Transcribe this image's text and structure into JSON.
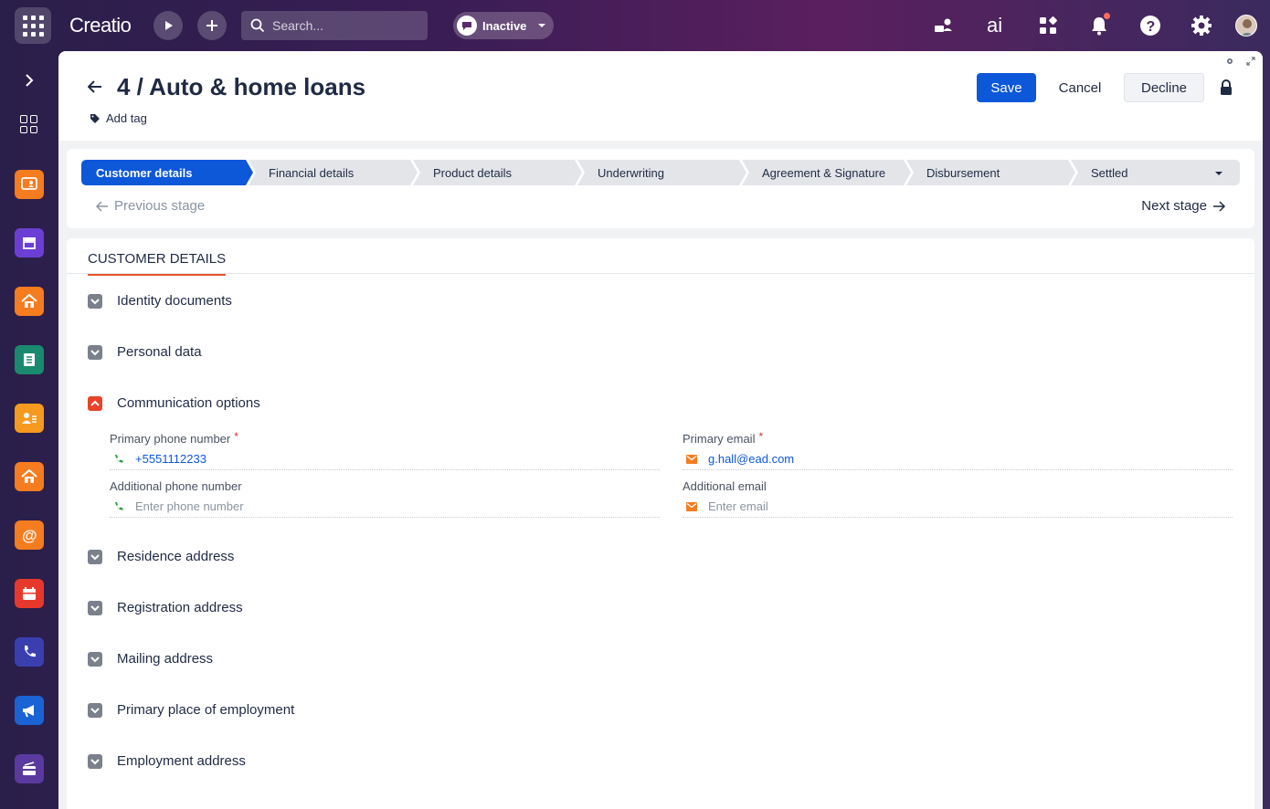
{
  "app": {
    "logo": "Creatio"
  },
  "search": {
    "placeholder": "Search..."
  },
  "status": {
    "label": "Inactive"
  },
  "record": {
    "title": "4 / Auto & home loans",
    "add_tag": "Add tag"
  },
  "actions": {
    "save": "Save",
    "cancel": "Cancel",
    "decline": "Decline"
  },
  "stages": [
    {
      "label": "Customer details",
      "active": true
    },
    {
      "label": "Financial details",
      "active": false
    },
    {
      "label": "Product details",
      "active": false
    },
    {
      "label": "Underwriting",
      "active": false
    },
    {
      "label": "Agreement & Signature",
      "active": false
    },
    {
      "label": "Disbursement",
      "active": false
    },
    {
      "label": "Settled",
      "active": false
    }
  ],
  "stage_nav": {
    "previous": "Previous stage",
    "next": "Next stage"
  },
  "tab": {
    "label": "CUSTOMER DETAILS"
  },
  "groups": {
    "identity": "Identity documents",
    "personal": "Personal data",
    "communication": "Communication options",
    "residence": "Residence address",
    "registration": "Registration address",
    "mailing": "Mailing address",
    "employment_primary": "Primary place of employment",
    "employment_address": "Employment address"
  },
  "fields": {
    "primary_phone": {
      "label": "Primary phone number",
      "value": "+5551112233"
    },
    "primary_email": {
      "label": "Primary email",
      "value": "g.hall@ead.com"
    },
    "additional_phone": {
      "label": "Additional phone number",
      "placeholder": "Enter phone number"
    },
    "additional_email": {
      "label": "Additional email",
      "placeholder": "Enter email"
    }
  },
  "colors": {
    "accent": "#0d57d9",
    "active_stage": "#0d57d9",
    "tab_underline": "#e8542b",
    "required": "#d9342b"
  },
  "icons": {
    "sidebar": [
      "contact-card-icon",
      "shop-icon",
      "home-icon",
      "ledger-icon",
      "person-list-icon",
      "home-icon",
      "at-icon",
      "calendar-icon",
      "phone-icon",
      "megaphone-icon",
      "card-icon"
    ]
  }
}
